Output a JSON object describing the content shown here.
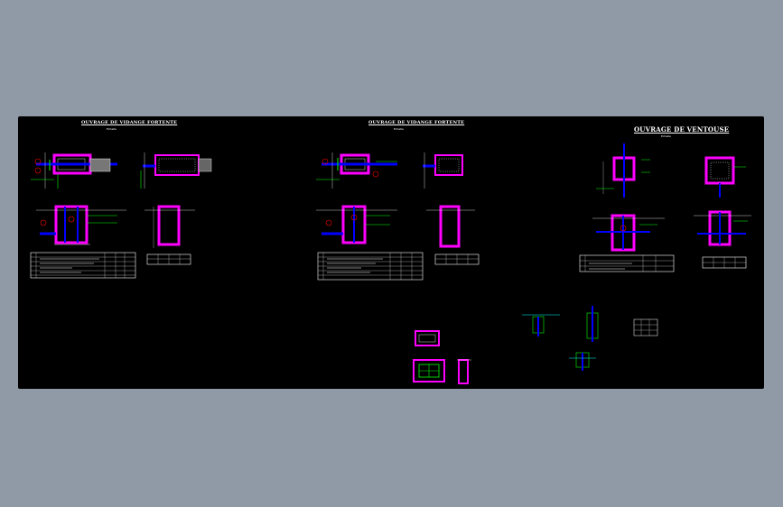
{
  "sheets": [
    {
      "title": "OUVRAGE DE VIDANGE FORTENTE",
      "subtitle": "Echelle"
    },
    {
      "title": "OUVRAGE DE VIDANGE FORTENTE",
      "subtitle": "Echelle"
    },
    {
      "title": "OUVRAGE DE VENTOUSE",
      "subtitle": "Echelle"
    }
  ],
  "colors": {
    "background": "#8f9aa6",
    "canvas": "#000000",
    "wall": "#ff00ff",
    "pipe": "#0000ff",
    "annotation": "#00ff00",
    "marker": "#ff0000",
    "cyan": "#00ffff",
    "yellow": "#ffff00",
    "white": "#ffffff"
  }
}
